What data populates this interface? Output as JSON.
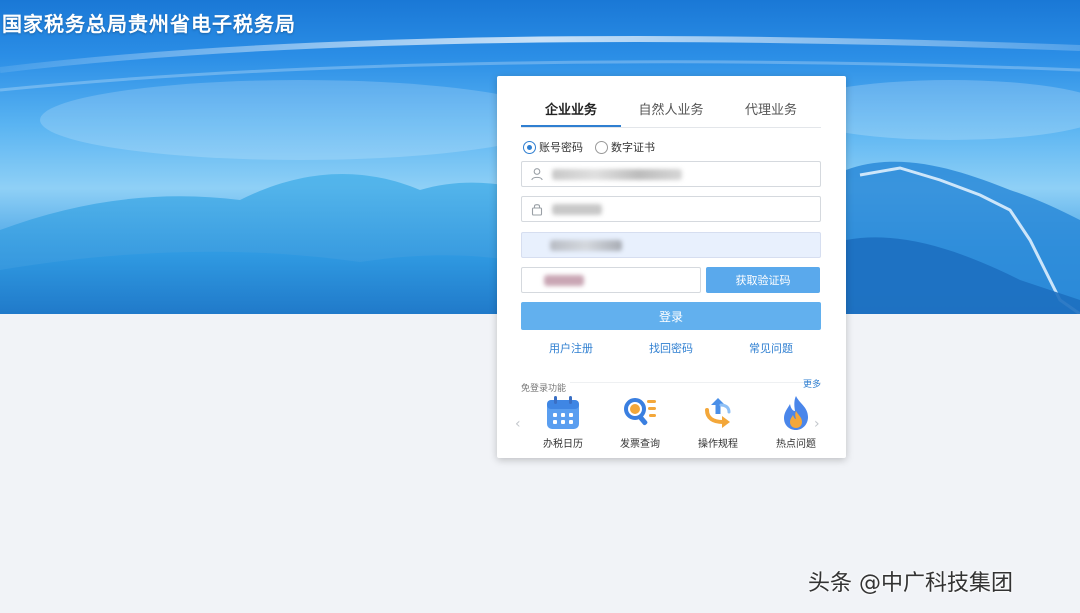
{
  "site": {
    "title": "国家税务总局贵州省电子税务局"
  },
  "login": {
    "tabs": [
      {
        "label": "企业业务",
        "active": true
      },
      {
        "label": "自然人业务",
        "active": false
      },
      {
        "label": "代理业务",
        "active": false
      }
    ],
    "modes": [
      {
        "label": "账号密码",
        "selected": true
      },
      {
        "label": "数字证书",
        "selected": false
      }
    ],
    "username_icon": "user-icon",
    "password_icon": "lock-icon",
    "captcha_button": "获取验证码",
    "login_button": "登录",
    "links": {
      "register": "用户注册",
      "recover": "找回密码",
      "faq": "常见问题"
    }
  },
  "quick": {
    "header": "免登录功能",
    "more": "更多",
    "items": [
      {
        "label": "办税日历",
        "icon": "calendar-icon"
      },
      {
        "label": "发票查询",
        "icon": "search-list-icon"
      },
      {
        "label": "操作规程",
        "icon": "flow-icon"
      },
      {
        "label": "热点问题",
        "icon": "fire-icon"
      }
    ]
  },
  "watermark": "头条 @中广科技集团",
  "colors": {
    "accent": "#2f7fd1",
    "button": "#62b0ee",
    "banner": "#2b8ee6"
  }
}
